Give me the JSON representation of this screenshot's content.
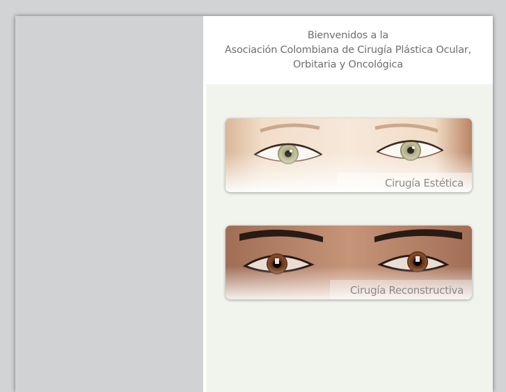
{
  "header": {
    "line1": "Bienvenidos a la",
    "line2": "Asociación Colombiana de Cirugía Plástica Ocular,",
    "line3": "Orbitaria y Oncológica"
  },
  "cards": [
    {
      "label": "Cirugía Estética",
      "image": "light-eyes-photo"
    },
    {
      "label": "Cirugía Reconstructiva",
      "image": "brown-eyes-photo"
    }
  ],
  "colors": {
    "background": "#d2d3d5",
    "content_background": "#f1f4ec",
    "header_text": "#6e6e70",
    "caption_text": "#8a8a8c"
  }
}
